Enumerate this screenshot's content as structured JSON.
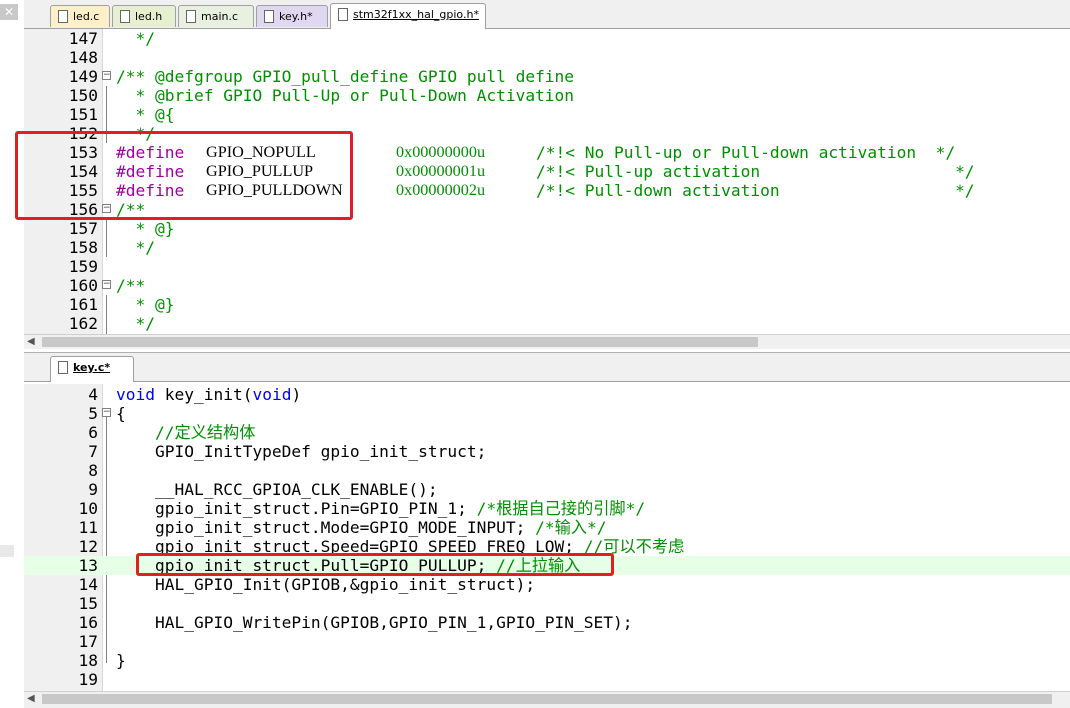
{
  "tabs_top": [
    {
      "label": "led.c"
    },
    {
      "label": "led.h"
    },
    {
      "label": "main.c"
    },
    {
      "label": "key.h*"
    },
    {
      "label": "stm32f1xx_hal_gpio.h*"
    }
  ],
  "tabs_bottom": [
    {
      "label": "key.c*"
    }
  ],
  "left_strip": {
    "close_glyph": "✕"
  },
  "top_code": [
    {
      "num": "147",
      "text": "  */"
    },
    {
      "num": "148",
      "text": ""
    },
    {
      "num": "149",
      "text": "/** @defgroup GPIO_pull_define GPIO pull define"
    },
    {
      "num": "150",
      "text": "  * @brief GPIO Pull-Up or Pull-Down Activation"
    },
    {
      "num": "151",
      "text": "  * @{"
    },
    {
      "num": "152",
      "text": "  */"
    },
    {
      "num": "153",
      "pre": "#define",
      "name": "GPIO_NOPULL",
      "val": "0x00000000u",
      "cmt": "/*!< No Pull-up or Pull-down activation  */"
    },
    {
      "num": "154",
      "pre": "#define",
      "name": "GPIO_PULLUP",
      "val": "0x00000001u",
      "cmt": "/*!< Pull-up activation                    */"
    },
    {
      "num": "155",
      "pre": "#define",
      "name": "GPIO_PULLDOWN",
      "val": "0x00000002u",
      "cmt": "/*!< Pull-down activation                  */"
    },
    {
      "num": "156",
      "text": "/**"
    },
    {
      "num": "157",
      "text": "  * @}"
    },
    {
      "num": "158",
      "text": "  */"
    },
    {
      "num": "159",
      "text": ""
    },
    {
      "num": "160",
      "text": "/**"
    },
    {
      "num": "161",
      "text": "  * @}"
    },
    {
      "num": "162",
      "text": "  */"
    }
  ],
  "bottom_code": [
    {
      "num": "4",
      "kw": "void",
      "name": " key_init(",
      "kw2": "void",
      "end": ")"
    },
    {
      "num": "5",
      "text": "{"
    },
    {
      "num": "6",
      "text": "    //定义结构体"
    },
    {
      "num": "7",
      "text": "    GPIO_InitTypeDef gpio_init_struct;"
    },
    {
      "num": "8",
      "text": ""
    },
    {
      "num": "9",
      "text": "    __HAL_RCC_GPIOA_CLK_ENABLE();"
    },
    {
      "num": "10",
      "code": "    gpio_init_struct.Pin=GPIO_PIN_1; ",
      "cmt": "/*根据自己接的引脚*/"
    },
    {
      "num": "11",
      "code": "    gpio_init_struct.Mode=GPIO_MODE_INPUT; ",
      "cmt": "/*输入*/"
    },
    {
      "num": "12",
      "code": "    gpio_init_struct.Speed=GPIO_SPEED_FREQ_LOW; ",
      "cmt": "//可以不考虑"
    },
    {
      "num": "13",
      "code": "    gpio_init_struct.Pull=GPIO_PULLUP; ",
      "cmt": "//上拉输入"
    },
    {
      "num": "14",
      "text": "    HAL_GPIO_Init(GPIOB,&gpio_init_struct);"
    },
    {
      "num": "15",
      "text": ""
    },
    {
      "num": "16",
      "text": "    HAL_GPIO_WritePin(GPIOB,GPIO_PIN_1,GPIO_PIN_SET);"
    },
    {
      "num": "17",
      "text": ""
    },
    {
      "num": "18",
      "text": "}"
    },
    {
      "num": "19",
      "text": ""
    }
  ],
  "colors": {
    "comment": "#009000",
    "keyword": "#0000ff",
    "preproc": "#a000a0",
    "highlight": "#e02020"
  }
}
